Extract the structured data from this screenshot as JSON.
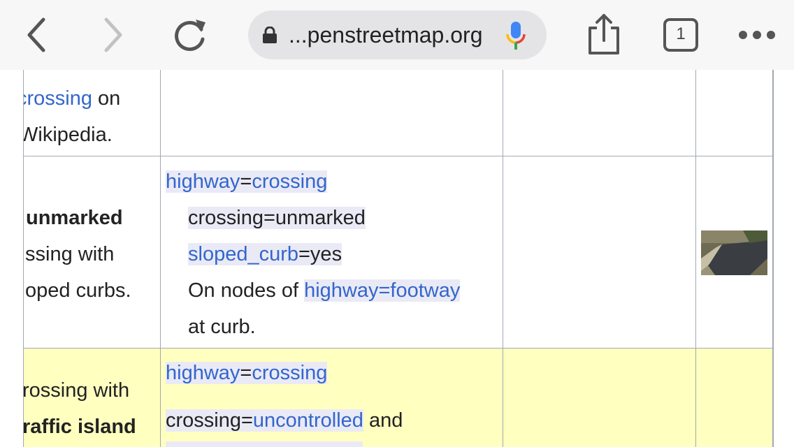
{
  "browser": {
    "url": "...penstreetmap.org",
    "tab_count": "1"
  },
  "row1": {
    "desc_line1_link": "crossing",
    "desc_line1_rest": " on",
    "desc_line2": "Wikipedia."
  },
  "row2": {
    "desc_title": "unmarked",
    "desc_line2": "ssing with",
    "desc_line3": "oped curbs.",
    "tag_key": "highway",
    "tag_eq": "=",
    "tag_value": "crossing",
    "sub1": "crossing=unmarked",
    "sub2_link": "sloped_curb",
    "sub2_rest": "=yes",
    "sub3_prefix": "On nodes of ",
    "sub3_key": "highway",
    "sub3_eq": "=",
    "sub3_value": "footway",
    "sub4": "at curb."
  },
  "row3": {
    "desc_line1": "rossing with",
    "desc_line2": "raffic island",
    "tag_key": "highway",
    "tag_eq": "=",
    "tag_value": "crossing",
    "line2_prefix": "crossing=",
    "line2_link": "uncontrolled",
    "line2_rest": " and"
  }
}
